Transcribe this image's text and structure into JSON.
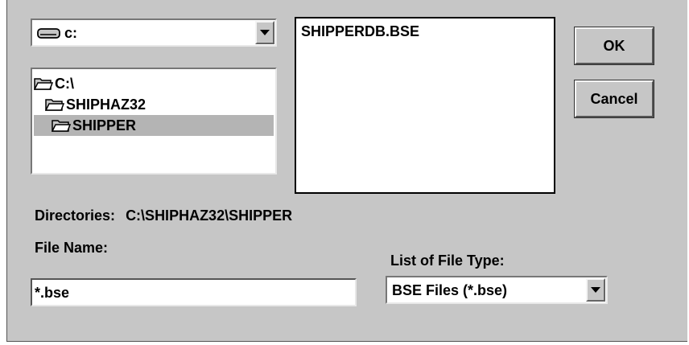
{
  "drive_select": {
    "value": "c:",
    "icon": "drive-icon"
  },
  "directory_tree": {
    "items": [
      {
        "label": "C:\\",
        "icon": "open-folder-icon",
        "selected": false
      },
      {
        "label": "SHIPHAZ32",
        "icon": "open-folder-icon",
        "selected": false
      },
      {
        "label": "SHIPPER",
        "icon": "open-folder-icon",
        "selected": true
      }
    ]
  },
  "file_list": {
    "items": [
      "SHIPPERDB.BSE"
    ]
  },
  "buttons": {
    "ok": "OK",
    "cancel": "Cancel"
  },
  "directories": {
    "label": "Directories:",
    "path": "C:\\SHIPHAZ32\\SHIPPER"
  },
  "file_name": {
    "label": "File Name:",
    "value": "*.bse"
  },
  "file_type": {
    "label": "List of File Type:",
    "value": "BSE Files (*.bse)"
  },
  "colors": {
    "dialog_bg": "#c6c6c6",
    "selection_bg": "#b4b4b4"
  }
}
